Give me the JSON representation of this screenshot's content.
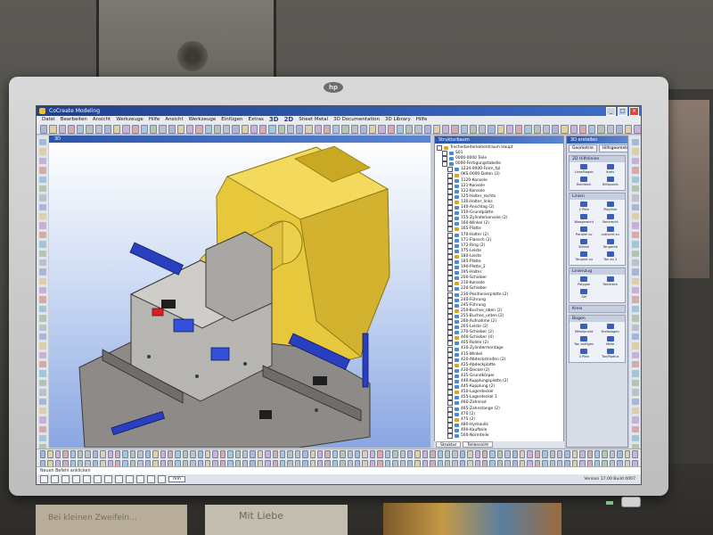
{
  "window": {
    "title": "CoCreate Modeling",
    "controls": [
      "_",
      "□",
      "×"
    ]
  },
  "menu": {
    "items": [
      "Datei",
      "Bearbeiten",
      "Ansicht",
      "Werkzeuge",
      "Hilfe",
      "Ansicht",
      "Werkzeuge",
      "Einfügen",
      "Extras"
    ],
    "mode_2d": "3D",
    "mode_3d": "2D",
    "extra_items": [
      "Sheet Metal",
      "3D Documentation",
      "3D Library",
      "Hilfe"
    ]
  },
  "viewport": {
    "title": "3D"
  },
  "tree": {
    "title": "Strukturbaum",
    "rows": [
      "Trocherbeiterkeitentraum Haupt",
      "S01",
      "0000-0000 Teile",
      "0000-Fertigungstabelle",
      "1234-0000-Form_fpl",
      "0KS-0000-Daten (2)",
      "1120-Konsole",
      "121-Konsole",
      "122-Konsole",
      "125-Halter_rechts",
      "130-Halter_links",
      "140-Anschlag (2)",
      "150-Grundplatte",
      "155-Zylinderkonsole (2)",
      "160-Winkel (2)",
      "165-Platte",
      "170-Halter (2)",
      "171-Flansch (2)",
      "172-Ring (2)",
      "175-Leiste",
      "180-Leiste",
      "185-Platte",
      "190-Platte_2",
      "195-Halter",
      "200-Schieber",
      "210-Konsole",
      "220-Schieber",
      "230-Positionierplatte (2)",
      "240-Führung",
      "245-Führung",
      "250-Buchse_oben (2)",
      "255-Buchse_unten (2)",
      "260-Aufnahme (2)",
      "265-Leiste (2)",
      "270-Schieber (2)",
      "400-Schieber (4)",
      "405-Rollen (2)",
      "410-Zylindermontage",
      "415-Winkel",
      "420-Abdeckstreifen (2)",
      "425-Abdeckplatte",
      "430-Deckel (2)",
      "435-Grundkörper",
      "440-Kupplungsplatte (2)",
      "445-Kupplung (2)",
      "450-Lagerdeckel",
      "455-Lagerdeckel 1",
      "460-Zahnrad",
      "465-Zahnstange (2)",
      "470 (2)",
      "475 (2)",
      "480-Hydraulik",
      "490-Kaufteile",
      "500-Normteile"
    ],
    "tabs": [
      "Struktur",
      "Teilansicht"
    ]
  },
  "function_panel": {
    "title": "3D erstellen",
    "tabs": [
      "Geometrie",
      "Hilfsgeometrie"
    ],
    "groups": [
      {
        "title": "2D Hilfslinien",
        "items": [
          "Linie/Bogen",
          "Kreis",
          "Rechteck",
          "Hilfspunkt"
        ]
      },
      {
        "title": "Linien",
        "items": [
          "2 Pkte",
          "Polylinie",
          "Waagerecht",
          "Senkrecht",
          "Parallel zu",
          "Lotrecht zu",
          "Winkel",
          "Tangente",
          "Tangent zu",
          "Tan an 2"
        ]
      },
      {
        "title": "Linienzug",
        "items": [
          "Polygon",
          "Rechteck",
          "Stil"
        ]
      },
      {
        "title": "Kreis",
        "items": []
      },
      {
        "title": "Bogen",
        "items": [
          "Mittelpunkt",
          "Kreisbogen",
          "Tan anfügen",
          "Mitte",
          "3 Pkte",
          "Tan/Radius"
        ]
      }
    ]
  },
  "command_line": {
    "text": "Neuen Befehl anklicken"
  },
  "status": {
    "unit": "mm",
    "clock": "Version 17.00 Build 0007"
  },
  "desk": {
    "card_left": "Bei kleinen Zweifeln...",
    "card_mid": "Mit Liebe"
  },
  "brand": {
    "logo": "hp",
    "label": "hp"
  }
}
